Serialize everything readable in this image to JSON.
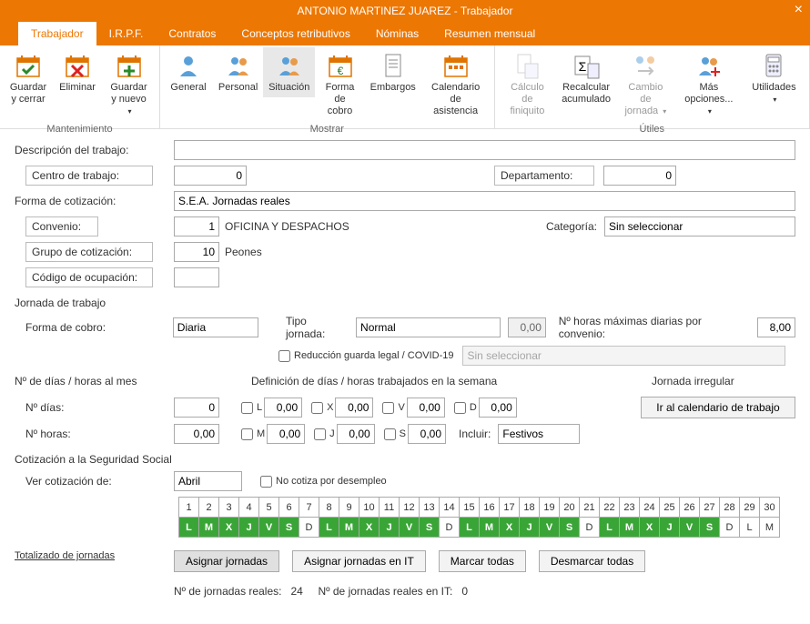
{
  "window": {
    "title": "ANTONIO MARTINEZ JUAREZ - Trabajador"
  },
  "tabs": {
    "items": [
      "Trabajador",
      "I.R.P.F.",
      "Contratos",
      "Conceptos retributivos",
      "Nóminas",
      "Resumen mensual"
    ],
    "active": 0
  },
  "ribbon": {
    "groups": [
      {
        "label": "Mantenimiento",
        "buttons": [
          {
            "name": "guardar-cerrar",
            "text": "Guardar\ny cerrar",
            "icon": "save-close"
          },
          {
            "name": "eliminar",
            "text": "Eliminar",
            "icon": "delete"
          },
          {
            "name": "guardar-nuevo",
            "text": "Guardar\ny nuevo",
            "icon": "save-new",
            "caret": true
          }
        ]
      },
      {
        "label": "Mostrar",
        "buttons": [
          {
            "name": "general",
            "text": "General",
            "icon": "person"
          },
          {
            "name": "personal",
            "text": "Personal",
            "icon": "people"
          },
          {
            "name": "situacion",
            "text": "Situación",
            "icon": "people2",
            "active": true
          },
          {
            "name": "forma-cobro",
            "text": "Forma\nde cobro",
            "icon": "calendar-money"
          },
          {
            "name": "embargos",
            "text": "Embargos",
            "icon": "doc"
          },
          {
            "name": "calendario-asistencia",
            "text": "Calendario\nde asistencia",
            "icon": "calendar"
          }
        ]
      },
      {
        "label": "Útiles",
        "buttons": [
          {
            "name": "calculo-finiquito",
            "text": "Cálculo de\nfiniquito",
            "icon": "calc-doc",
            "disabled": true
          },
          {
            "name": "recalcular-acumulado",
            "text": "Recalcular\nacumulado",
            "icon": "sigma-calc"
          },
          {
            "name": "cambio-jornada",
            "text": "Cambio de\njornada",
            "icon": "swap",
            "disabled": true,
            "caret": true
          },
          {
            "name": "mas-opciones",
            "text": "Más\nopciones...",
            "icon": "people-plus",
            "caret": true
          },
          {
            "name": "utilidades",
            "text": "Utilidades",
            "icon": "calculator",
            "caret": true
          }
        ]
      }
    ]
  },
  "form": {
    "descripcion_label": "Descripción del trabajo:",
    "descripcion": "",
    "centro_label": "Centro de trabajo:",
    "centro": "0",
    "departamento_label": "Departamento:",
    "departamento": "0",
    "forma_cotizacion_label": "Forma de cotización:",
    "forma_cotizacion": "S.E.A. Jornadas reales",
    "convenio_label": "Convenio:",
    "convenio_num": "1",
    "convenio_txt": "OFICINA Y DESPACHOS",
    "categoria_label": "Categoría:",
    "categoria": "Sin seleccionar",
    "grupo_cotizacion_label": "Grupo de cotización:",
    "grupo_cotizacion_num": "10",
    "grupo_cotizacion_txt": "Peones",
    "codigo_ocupacion_label": "Código de ocupación:",
    "codigo_ocupacion": "",
    "jornada_title": "Jornada de trabajo",
    "forma_cobro_label": "Forma de cobro:",
    "forma_cobro": "Diaria",
    "tipo_jornada_label": "Tipo jornada:",
    "tipo_jornada": "Normal",
    "tipo_jornada_horas": "0,00",
    "horas_max_label": "Nº horas máximas diarias por convenio:",
    "horas_max": "8,00",
    "reduccion_label": "Reducción guarda legal / COVID-19",
    "reduccion_sel": "Sin seleccionar",
    "dias_horas_title": "Nº de días / horas al mes",
    "def_dias_title": "Definición de días / horas trabajados en la semana",
    "jornada_irregular_title": "Jornada irregular",
    "n_dias_label": "Nº días:",
    "n_dias": "0",
    "n_horas_label": "Nº horas:",
    "n_horas": "0,00",
    "days": {
      "L": "0,00",
      "M": "0,00",
      "X": "0,00",
      "J": "0,00",
      "V": "0,00",
      "S": "0,00",
      "D": "0,00"
    },
    "incluir_label": "Incluir:",
    "incluir": "Festivos",
    "ir_calendario_btn": "Ir al calendario de trabajo",
    "cotizacion_ss_title": "Cotización a la Seguridad Social",
    "ver_cotizacion_label": "Ver cotización de:",
    "ver_cotizacion": "Abril",
    "no_cotiza_label": "No cotiza por desempleo",
    "calendar": {
      "numbers": [
        "1",
        "2",
        "3",
        "4",
        "5",
        "6",
        "7",
        "8",
        "9",
        "10",
        "11",
        "12",
        "13",
        "14",
        "15",
        "16",
        "17",
        "18",
        "19",
        "20",
        "21",
        "22",
        "23",
        "24",
        "25",
        "26",
        "27",
        "28",
        "29",
        "30"
      ],
      "letters": [
        "L",
        "M",
        "X",
        "J",
        "V",
        "S",
        "D",
        "L",
        "M",
        "X",
        "J",
        "V",
        "S",
        "D",
        "L",
        "M",
        "X",
        "J",
        "V",
        "S",
        "D",
        "L",
        "M",
        "X",
        "J",
        "V",
        "S",
        "D",
        "L",
        "M"
      ],
      "work": [
        1,
        1,
        1,
        1,
        1,
        1,
        0,
        1,
        1,
        1,
        1,
        1,
        1,
        0,
        1,
        1,
        1,
        1,
        1,
        1,
        0,
        1,
        1,
        1,
        1,
        1,
        1,
        0,
        0,
        0
      ]
    },
    "totalizado_link": "Totalizado de jornadas",
    "asignar_btn": "Asignar jornadas",
    "asignar_it_btn": "Asignar jornadas en IT",
    "marcar_btn": "Marcar todas",
    "desmarcar_btn": "Desmarcar todas",
    "jornadas_reales_label": "Nº de jornadas reales:",
    "jornadas_reales": "24",
    "jornadas_it_label": "Nº de jornadas reales en IT:",
    "jornadas_it": "0"
  }
}
